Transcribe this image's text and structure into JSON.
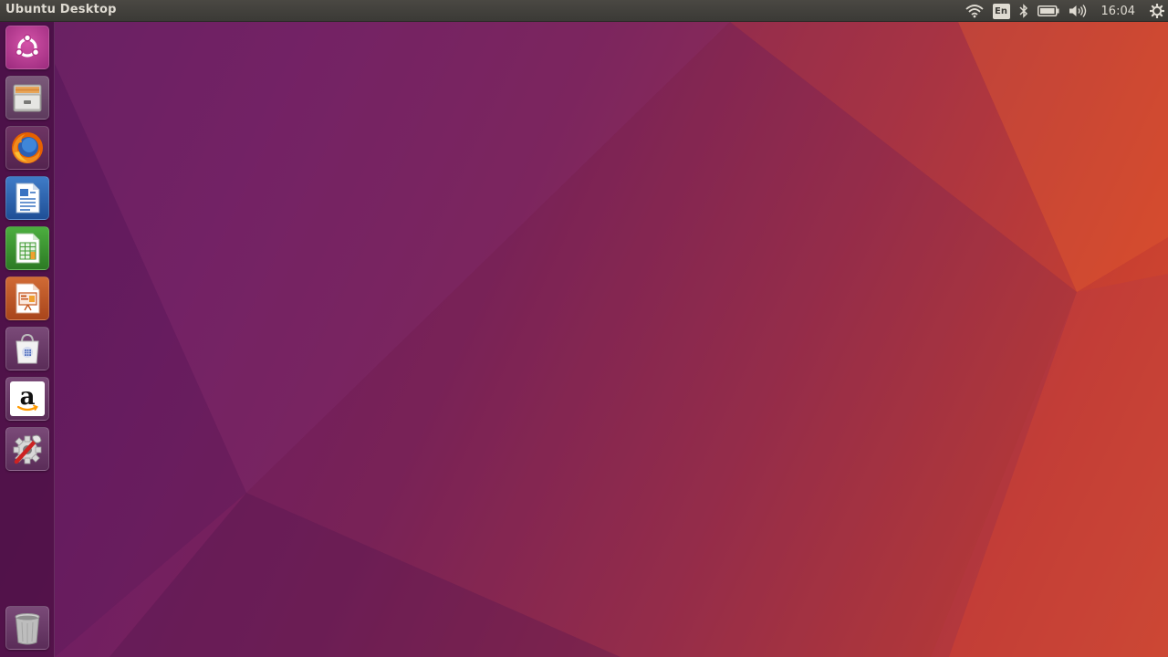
{
  "panel": {
    "title": "Ubuntu Desktop",
    "clock": "16:04",
    "keyboard_layout": "En",
    "indicators": [
      "wifi-icon",
      "keyboard-layout-icon",
      "bluetooth-icon",
      "battery-icon",
      "volume-icon",
      "clock",
      "system-gear-icon"
    ]
  },
  "launcher": {
    "items": [
      {
        "name": "dash-home",
        "icon": "ubuntu-logo-icon",
        "color": "#b5338a"
      },
      {
        "name": "files",
        "icon": "file-cabinet-icon",
        "color": "#8a8a88"
      },
      {
        "name": "firefox",
        "icon": "firefox-icon",
        "color": "#e66000"
      },
      {
        "name": "libreoffice-writer",
        "icon": "writer-document-icon",
        "color": "#2a5ea8"
      },
      {
        "name": "libreoffice-calc",
        "icon": "calc-spreadsheet-icon",
        "color": "#3e9a32"
      },
      {
        "name": "libreoffice-impress",
        "icon": "impress-presentation-icon",
        "color": "#c4561f"
      },
      {
        "name": "ubuntu-software",
        "icon": "software-bag-icon",
        "color": "#e8e8e8"
      },
      {
        "name": "amazon",
        "icon": "amazon-icon",
        "color": "#ffffff"
      },
      {
        "name": "system-settings",
        "icon": "settings-wrench-icon",
        "color": "#cc2222"
      }
    ],
    "trash": {
      "name": "trash",
      "icon": "trash-icon"
    }
  },
  "colors": {
    "panel_bg": "#3c3b37",
    "panel_text": "#dfdbd2",
    "wallpaper_left": "#5e1b5f",
    "wallpaper_right": "#d8502c"
  }
}
